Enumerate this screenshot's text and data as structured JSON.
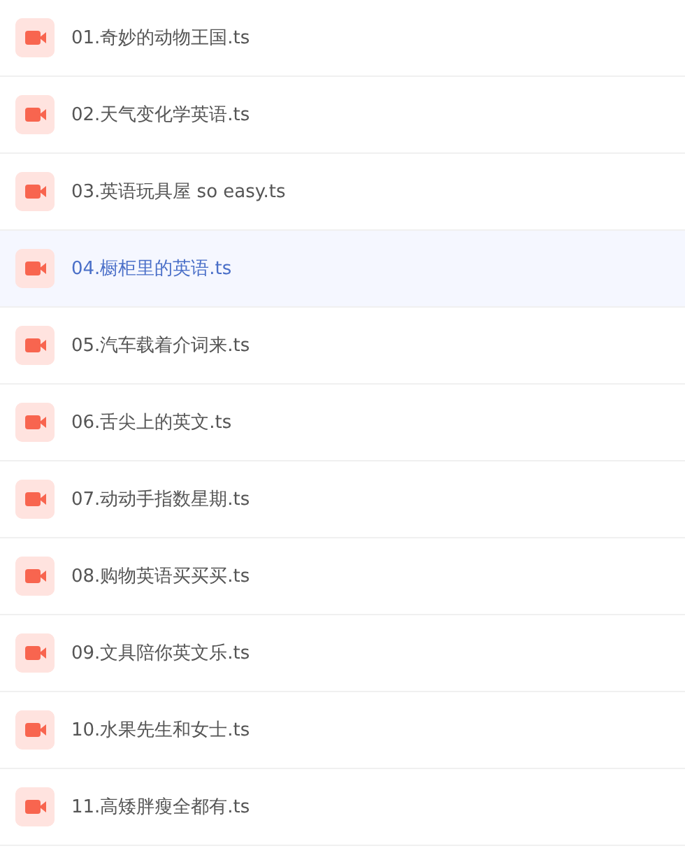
{
  "files": [
    {
      "name": "01.奇妙的动物王国.ts",
      "selected": false
    },
    {
      "name": "02.天气变化学英语.ts",
      "selected": false
    },
    {
      "name": "03.英语玩具屋 so easy.ts",
      "selected": false
    },
    {
      "name": "04.橱柜里的英语.ts",
      "selected": true
    },
    {
      "name": "05.汽车载着介词来.ts",
      "selected": false
    },
    {
      "name": "06.舌尖上的英文.ts",
      "selected": false
    },
    {
      "name": "07.动动手指数星期.ts",
      "selected": false
    },
    {
      "name": "08.购物英语买买买.ts",
      "selected": false
    },
    {
      "name": "09.文具陪你英文乐.ts",
      "selected": false
    },
    {
      "name": "10.水果先生和女士.ts",
      "selected": false
    },
    {
      "name": "11.高矮胖瘦全都有.ts",
      "selected": false
    }
  ]
}
